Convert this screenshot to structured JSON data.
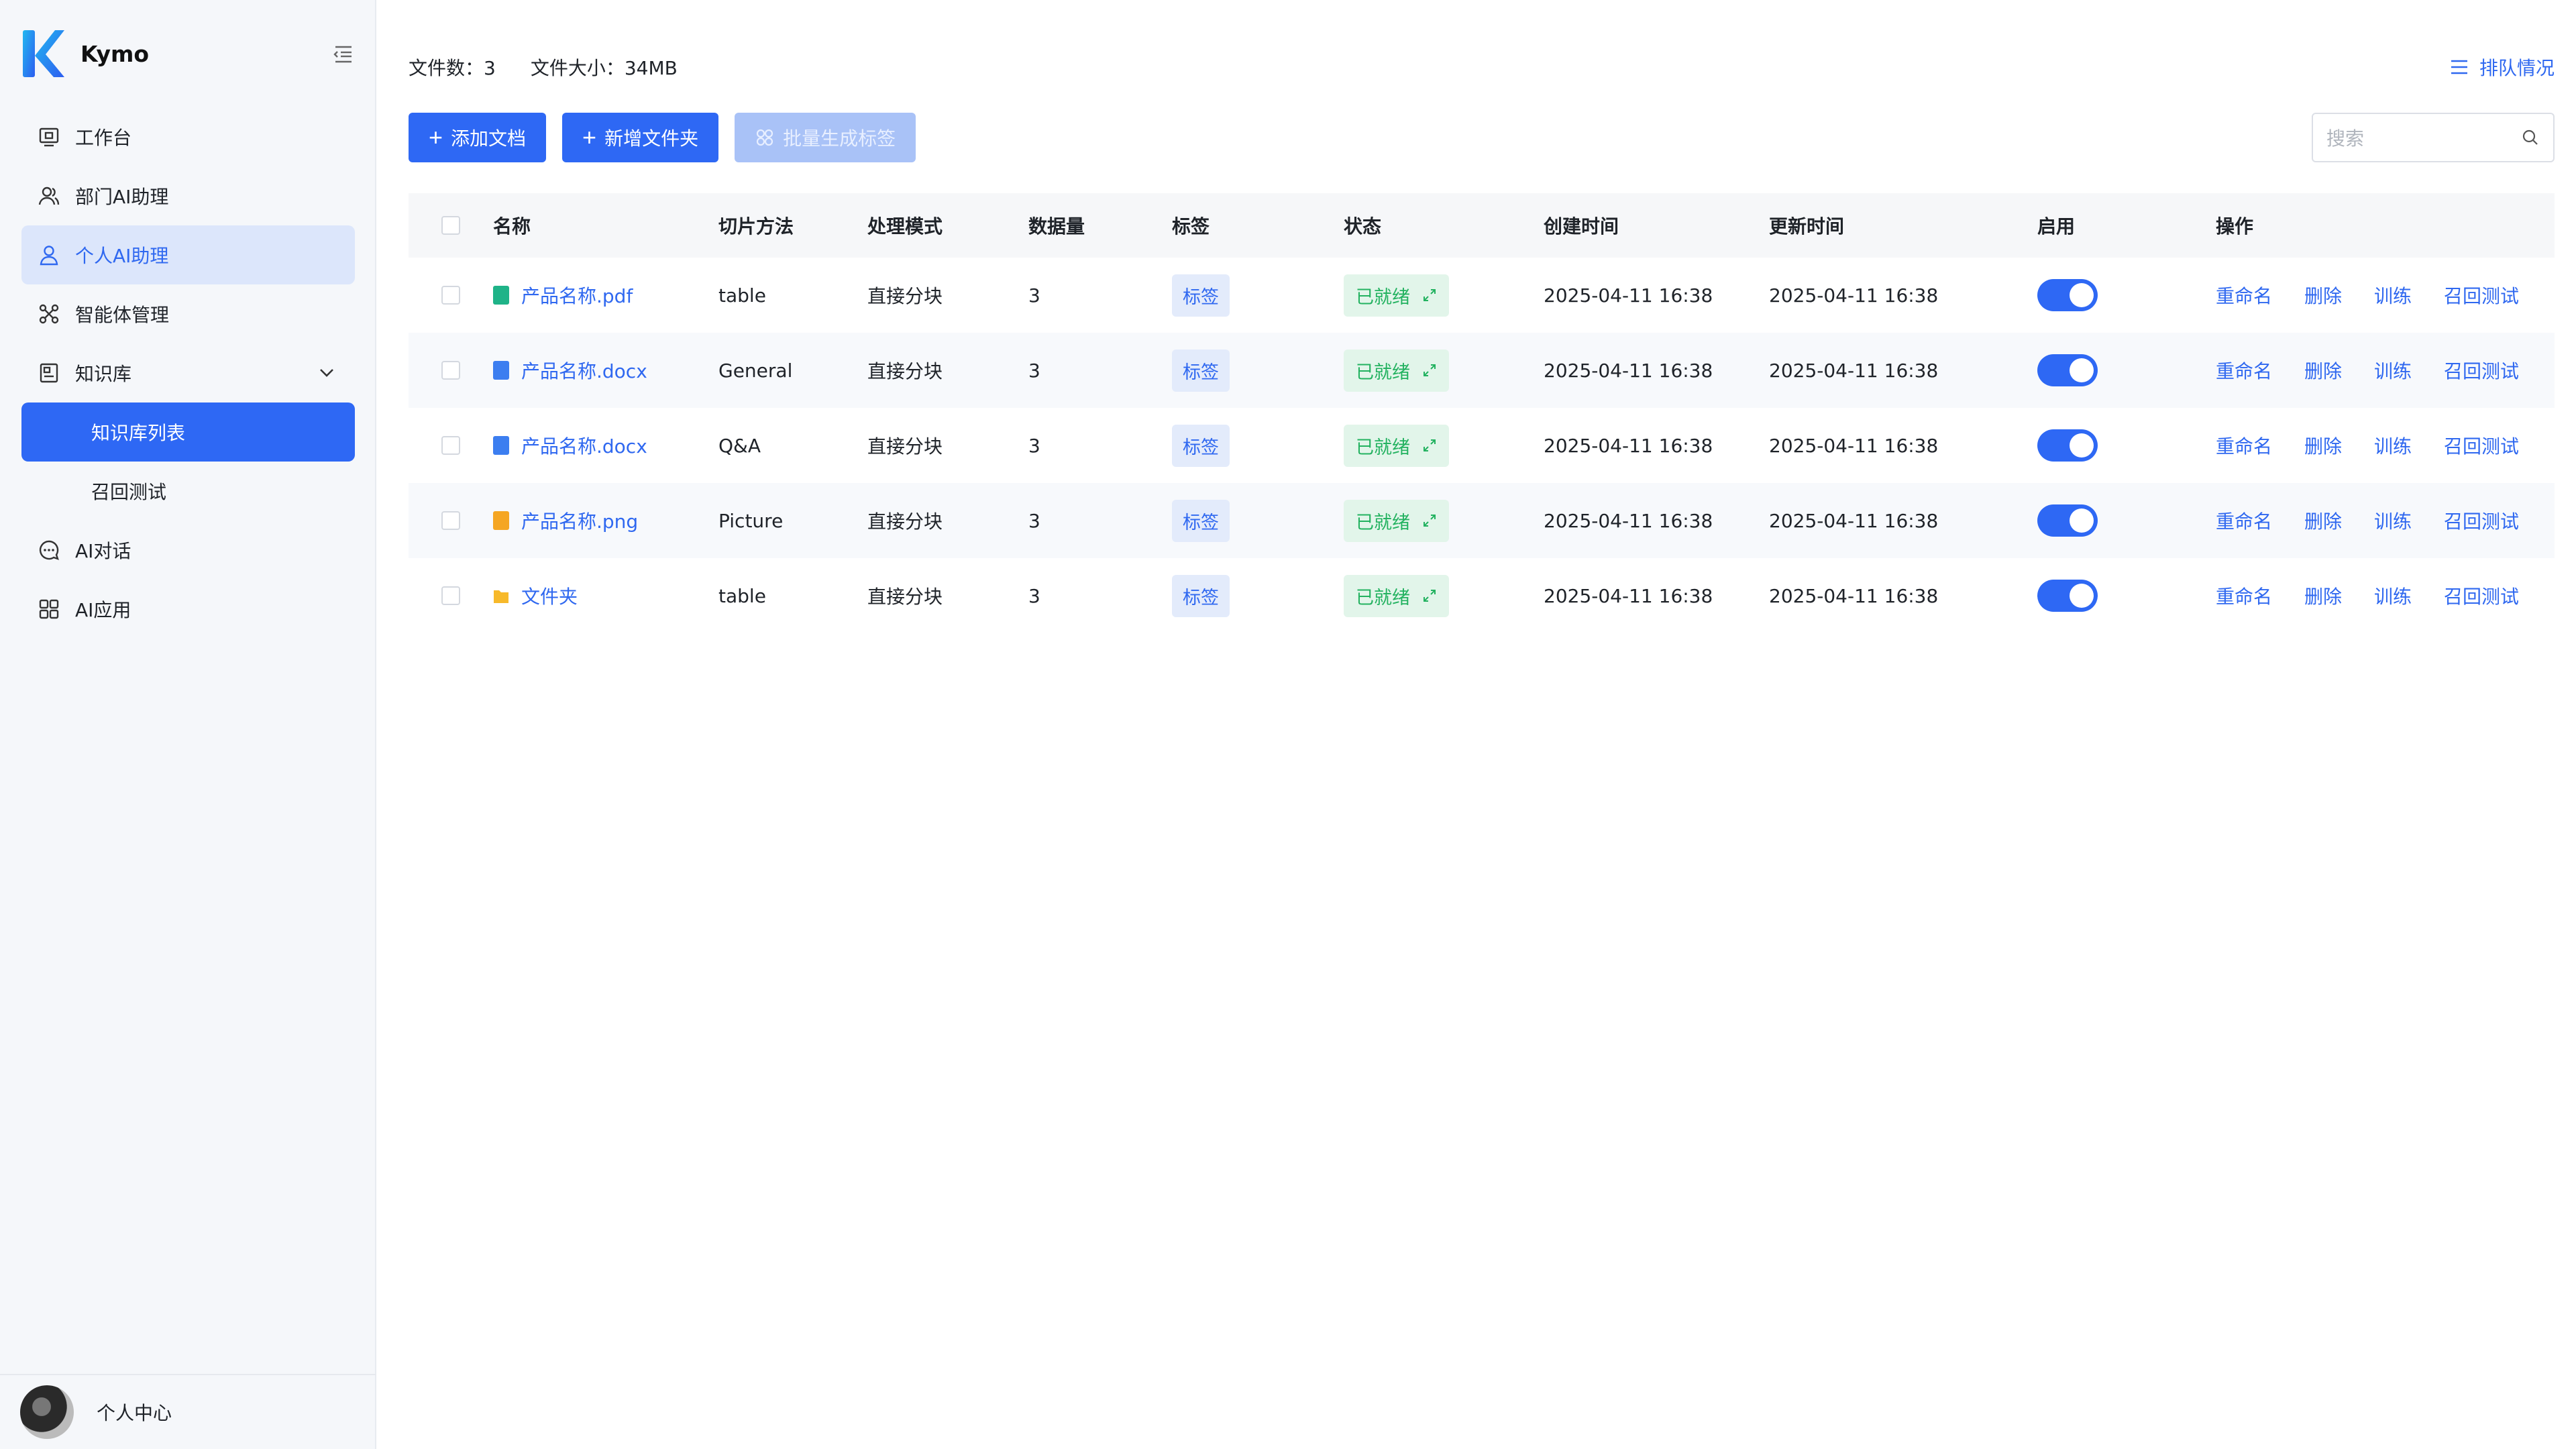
{
  "app": {
    "name": "Kymo"
  },
  "sidebar": {
    "items": [
      {
        "label": "工作台",
        "icon": "monitor-icon"
      },
      {
        "label": "部门AI助理",
        "icon": "users-icon"
      },
      {
        "label": "个人AI助理",
        "icon": "user-icon"
      },
      {
        "label": "智能体管理",
        "icon": "nodes-icon"
      },
      {
        "label": "知识库",
        "icon": "book-icon"
      },
      {
        "label": "知识库列表"
      },
      {
        "label": "召回测试"
      },
      {
        "label": "AI对话",
        "icon": "chat-icon"
      },
      {
        "label": "AI应用",
        "icon": "grid-icon"
      }
    ],
    "profile_label": "个人中心"
  },
  "stats": {
    "file_count": "文件数：3",
    "file_size": "文件大小：34MB"
  },
  "queue_label": "排队情况",
  "toolbar": {
    "add_doc": "添加文档",
    "new_folder": "新增文件夹",
    "batch_tags": "批量生成标签"
  },
  "search": {
    "placeholder": "搜索"
  },
  "table": {
    "headers": [
      "名称",
      "切片方法",
      "处理模式",
      "数据量",
      "标签",
      "状态",
      "创建时间",
      "更新时间",
      "启用",
      "操作"
    ],
    "rows": [
      {
        "name": "产品名称.pdf",
        "type": "pdf",
        "slice": "table",
        "mode": "直接分块",
        "count": "3",
        "tag": "标签",
        "status": "已就绪",
        "created": "2025-04-11 16:38",
        "updated": "2025-04-11  16:38",
        "enabled": true
      },
      {
        "name": "产品名称.docx",
        "type": "docx",
        "slice": "General",
        "mode": "直接分块",
        "count": "3",
        "tag": "标签",
        "status": "已就绪",
        "created": "2025-04-11 16:38",
        "updated": "2025-04-11  16:38",
        "enabled": true
      },
      {
        "name": "产品名称.docx",
        "type": "docx",
        "slice": "Q&A",
        "mode": "直接分块",
        "count": "3",
        "tag": "标签",
        "status": "已就绪",
        "created": "2025-04-11 16:38",
        "updated": "2025-04-11  16:38",
        "enabled": true
      },
      {
        "name": "产品名称.png",
        "type": "png",
        "slice": "Picture",
        "mode": "直接分块",
        "count": "3",
        "tag": "标签",
        "status": "已就绪",
        "created": "2025-04-11 16:38",
        "updated": "2025-04-11  16:38",
        "enabled": true
      },
      {
        "name": "文件夹",
        "type": "folder",
        "slice": "table",
        "mode": "直接分块",
        "count": "3",
        "tag": "标签",
        "status": "已就绪",
        "created": "2025-04-11 16:38",
        "updated": "2025-04-11  16:38",
        "enabled": true
      }
    ],
    "ops": [
      "重命名",
      "删除",
      "训练",
      "召回测试"
    ]
  },
  "colors": {
    "primary": "#2e68f4",
    "pdf": "#1fb388",
    "docx": "#3c7ef0",
    "png": "#f5a623",
    "folder": "#f7b92a",
    "ready": "#23b260"
  }
}
